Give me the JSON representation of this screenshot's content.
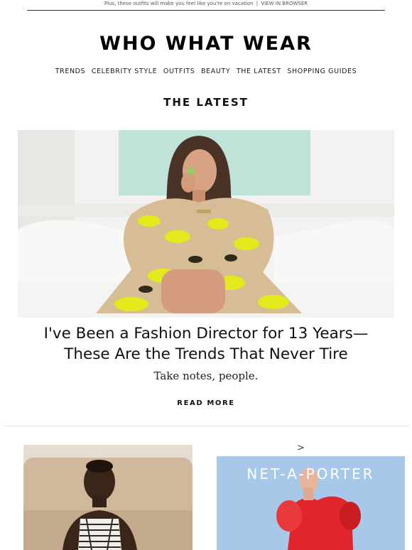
{
  "preheader": {
    "text": "Plus, these outfits will make you feel like you're on vacation",
    "separator": "|",
    "link_label": "VIEW IN BROWSER"
  },
  "brand": {
    "logo_text": "WHO WHAT WEAR"
  },
  "nav": {
    "items": [
      {
        "label": "TRENDS"
      },
      {
        "label": "CELEBRITY STYLE"
      },
      {
        "label": "OUTFITS"
      },
      {
        "label": "BEAUTY"
      },
      {
        "label": "THE LATEST"
      },
      {
        "label": "SHOPPING GUIDES"
      }
    ]
  },
  "section": {
    "title": "THE LATEST"
  },
  "feature": {
    "headline_line1": "I've Been a Fashion Director for 13 Years—",
    "headline_line2": "These Are the Trends That Never Tire",
    "dek": "Take notes, people.",
    "cta_label": "READ MORE"
  },
  "promo": {
    "chevron": ">",
    "ad_logo_text": "NET-A-PORTER"
  },
  "colors": {
    "background": "#ffffff",
    "text": "#111111",
    "ad_background": "#a7c8e8",
    "dress_yellow": "#e3ea1c",
    "red_dress": "#e0252b"
  }
}
